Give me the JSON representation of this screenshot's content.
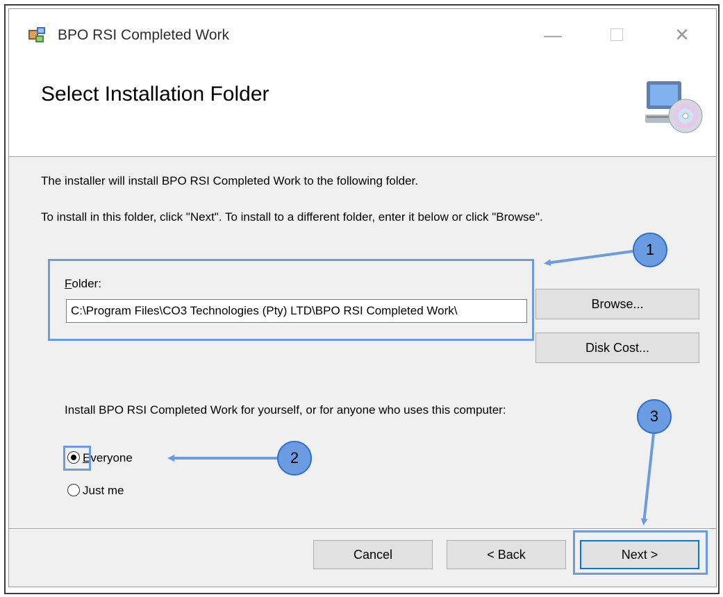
{
  "window": {
    "title": "BPO RSI Completed Work"
  },
  "header": {
    "title": "Select Installation Folder"
  },
  "body": {
    "line1": "The installer will install BPO RSI Completed Work to the following folder.",
    "line2": "To install in this folder, click \"Next\". To install to a different folder, enter it below or click \"Browse\".",
    "folder_label_first": "F",
    "folder_label_rest": "older:",
    "folder_value": "C:\\Program Files\\CO3 Technologies (Pty) LTD\\BPO RSI Completed Work\\",
    "install_for": "Install BPO RSI Completed Work for yourself, or for anyone who uses this computer:"
  },
  "buttons": {
    "browse": "Browse...",
    "disk_cost": "Disk Cost...",
    "cancel": "Cancel",
    "back": "< Back",
    "next": "Next >"
  },
  "options": [
    {
      "label_first": "E",
      "label_rest": "veryone",
      "selected": true
    },
    {
      "label": "Just me",
      "selected": false
    }
  ],
  "annotations": [
    "1",
    "2",
    "3"
  ],
  "colors": {
    "annotation": "#6b9be0",
    "annotation_border": "#2f6fca",
    "window_bg": "#f0f0f0"
  },
  "icons": [
    "installer-app-icon",
    "minimize-icon",
    "maximize-icon",
    "close-icon",
    "computer-cd-icon"
  ]
}
